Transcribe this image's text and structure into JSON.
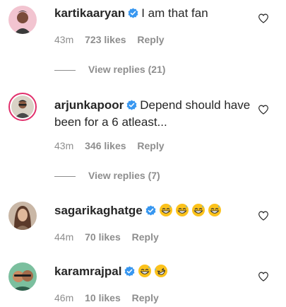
{
  "comments": [
    {
      "username": "kartikaaryan",
      "text": "I am that fan",
      "time": "43m",
      "likes": "723 likes",
      "reply": "Reply",
      "view_replies": "View replies (21)",
      "verified": true
    },
    {
      "username": "arjunkapoor",
      "text": "Depend should have been for a 6 atleast...",
      "time": "43m",
      "likes": "346 likes",
      "reply": "Reply",
      "view_replies": "View replies (7)",
      "verified": true
    },
    {
      "username": "sagarikaghatge",
      "text": "",
      "time": "44m",
      "likes": "70 likes",
      "reply": "Reply",
      "emojis": [
        "grinning-sweat-emoji",
        "grinning-sweat-emoji",
        "grinning-sweat-emoji",
        "grinning-sweat-emoji"
      ],
      "verified": true
    },
    {
      "username": "karamrajpal",
      "text": "",
      "time": "46m",
      "likes": "10 likes",
      "reply": "Reply",
      "emojis": [
        "grinning-sweat-emoji",
        "rolling-laughing-emoji"
      ],
      "verified": true
    }
  ],
  "colors": {
    "text": "#262626",
    "muted": "#8e8e8e",
    "verified": "#3897f0",
    "story_ring": "#e1306c"
  },
  "icons": {
    "like": "heart-outline-icon",
    "verified": "verified-badge-icon"
  }
}
